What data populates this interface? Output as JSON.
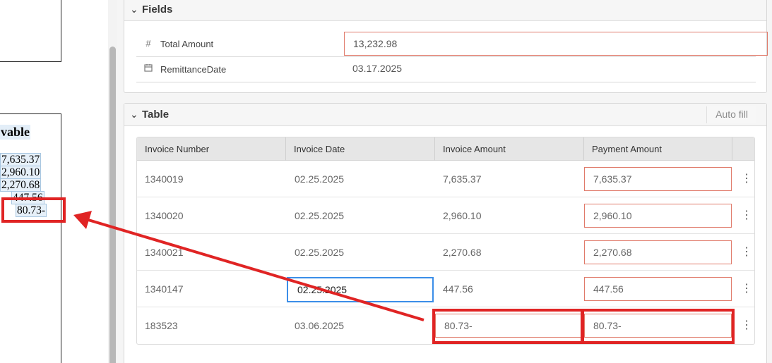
{
  "document": {
    "heading": "vable",
    "amounts": [
      "7,635.37",
      "2,960.10",
      "2,270.68",
      "447.56",
      "80.73-"
    ]
  },
  "fields_section": {
    "title": "Fields",
    "total_amount": {
      "label": "Total Amount",
      "value": "13,232.98",
      "icon": "hash-icon"
    },
    "remittance_date": {
      "label": "RemittanceDate",
      "value": "03.17.2025",
      "icon": "calendar-icon"
    }
  },
  "table_section": {
    "title": "Table",
    "autofill_label": "Auto fill",
    "columns": [
      "Invoice Number",
      "Invoice Date",
      "Invoice Amount",
      "Payment Amount"
    ],
    "rows": [
      {
        "invoice_number": "1340019",
        "invoice_date": "02.25.2025",
        "invoice_amount": "7,635.37",
        "payment_amount": "7,635.37"
      },
      {
        "invoice_number": "1340020",
        "invoice_date": "02.25.2025",
        "invoice_amount": "2,960.10",
        "payment_amount": "2,960.10"
      },
      {
        "invoice_number": "1340021",
        "invoice_date": "02.25.2025",
        "invoice_amount": "2,270.68",
        "payment_amount": "2,270.68"
      },
      {
        "invoice_number": "1340147",
        "invoice_date": "02.25.2025",
        "invoice_amount": "447.56",
        "payment_amount": "447.56"
      },
      {
        "invoice_number": "183523",
        "invoice_date": "03.06.2025",
        "invoice_amount": "80.73-",
        "payment_amount": "80.73-"
      }
    ]
  },
  "colors": {
    "annotation_red": "#e02424",
    "focus_blue": "#3b8ee8",
    "input_border": "#e07a6a"
  }
}
